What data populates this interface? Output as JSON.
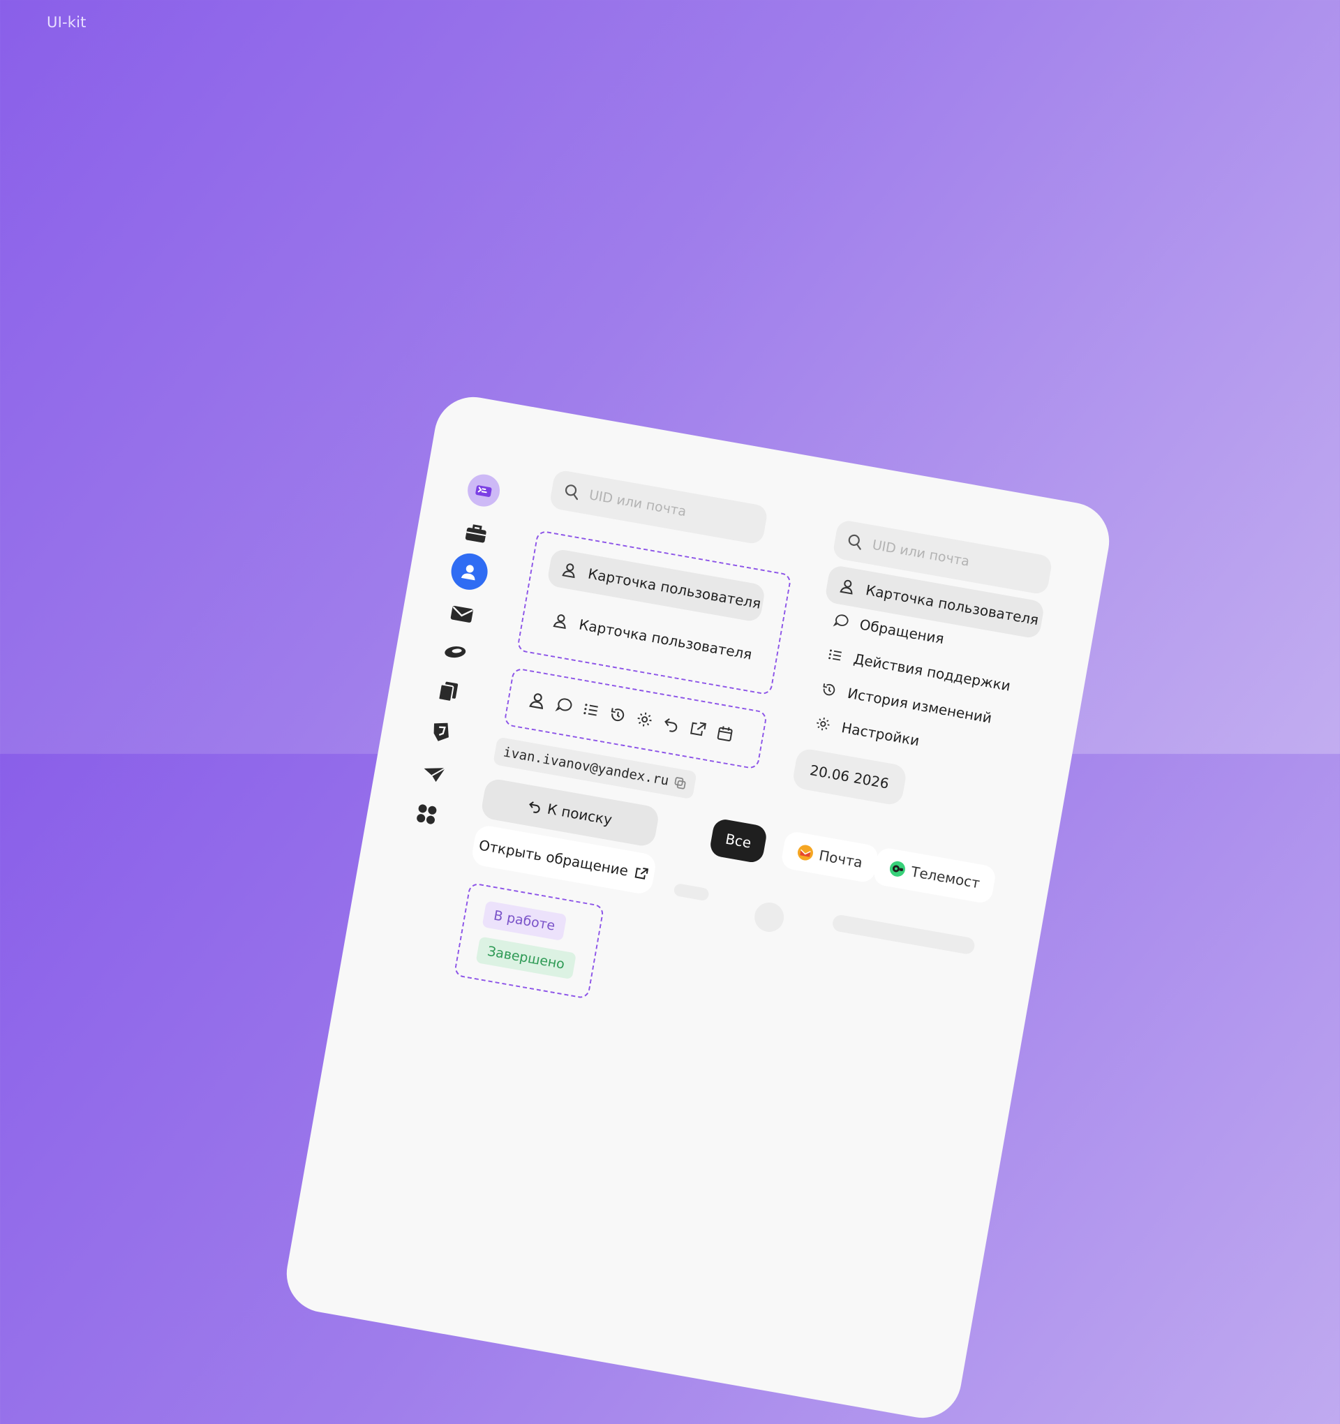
{
  "page": {
    "title": "UI-kit"
  },
  "sidebar": {
    "items": [
      {
        "icon": "yandex-id-logo-icon"
      },
      {
        "icon": "briefcase-icon"
      },
      {
        "icon": "user-icon",
        "active": true
      },
      {
        "icon": "mail-icon"
      },
      {
        "icon": "disk-icon"
      },
      {
        "icon": "documents-icon"
      },
      {
        "icon": "shield-icon"
      },
      {
        "icon": "send-icon"
      },
      {
        "icon": "apps-icon"
      }
    ]
  },
  "search_small": {
    "placeholder": "UID или почта"
  },
  "search_panel": {
    "placeholder": "UID или почта"
  },
  "nav_variants": [
    {
      "label": "Карточка пользователя",
      "state": "active",
      "icon": "user-icon"
    },
    {
      "label": "Карточка пользователя",
      "state": "default",
      "icon": "user-icon"
    }
  ],
  "icon_set": [
    "user-icon",
    "chat-icon",
    "list-icon",
    "history-icon",
    "settings-icon",
    "undo-icon",
    "external-link-icon",
    "calendar-icon"
  ],
  "nav_menu": [
    {
      "label": "Карточка пользователя",
      "icon": "user-icon",
      "active": true
    },
    {
      "label": "Обращения",
      "icon": "chat-icon"
    },
    {
      "label": "Действия поддержки",
      "icon": "list-icon"
    },
    {
      "label": "История изменений",
      "icon": "history-icon"
    },
    {
      "label": "Настройки",
      "icon": "settings-icon"
    }
  ],
  "email": {
    "value": "ivan.ivanov@yandex.ru",
    "copy_icon": "copy-icon"
  },
  "buttons": {
    "back_to_search": "К поиску",
    "open_ticket": "Открыть обращение"
  },
  "statuses": [
    {
      "label": "В работе",
      "color": "#7a53c9"
    },
    {
      "label": "Завершено",
      "color": "#2e9a55"
    }
  ],
  "date": {
    "value": "20.06 2026"
  },
  "filter_chips": [
    {
      "label": "Все",
      "selected": true
    },
    {
      "label": "Почта",
      "icon": "yandex-mail-icon"
    },
    {
      "label": "Телемост",
      "icon": "telemost-icon"
    }
  ],
  "colors": {
    "accent": "#8d55e8",
    "primary_blue": "#2f6cf3",
    "background_start": "#8a5fe9",
    "background_end": "#c2adf0"
  }
}
